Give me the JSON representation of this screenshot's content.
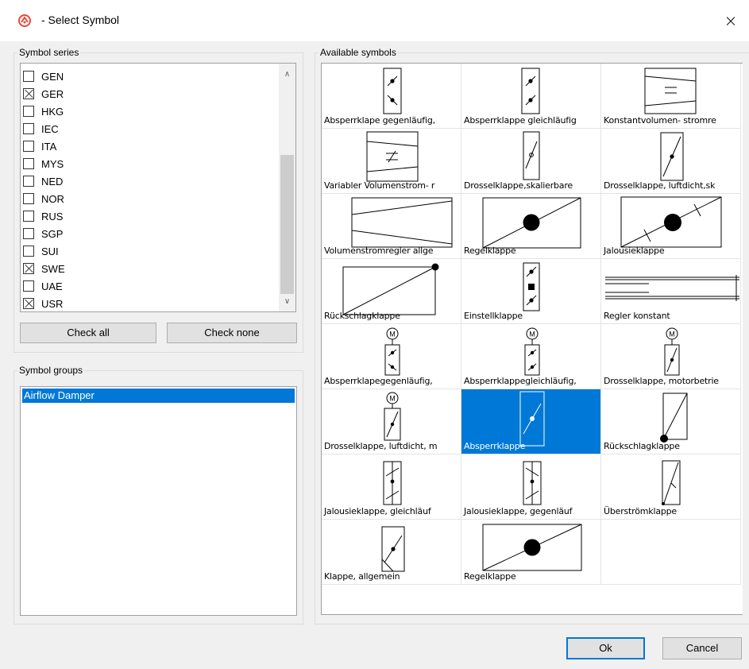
{
  "window": {
    "title": "- Select Symbol",
    "close_glyph": "×",
    "icon": "app-logo-icon"
  },
  "series": {
    "legend": "Symbol series",
    "items": [
      {
        "label": "GEN",
        "checked": false
      },
      {
        "label": "GER",
        "checked": true
      },
      {
        "label": "HKG",
        "checked": false
      },
      {
        "label": "IEC",
        "checked": false
      },
      {
        "label": "ITA",
        "checked": false
      },
      {
        "label": "MYS",
        "checked": false
      },
      {
        "label": "NED",
        "checked": false
      },
      {
        "label": "NOR",
        "checked": false
      },
      {
        "label": "RUS",
        "checked": false
      },
      {
        "label": "SGP",
        "checked": false
      },
      {
        "label": "SUI",
        "checked": false
      },
      {
        "label": "SWE",
        "checked": true
      },
      {
        "label": "UAE",
        "checked": false
      },
      {
        "label": "USR",
        "checked": true
      }
    ],
    "check_all_label": "Check all",
    "check_none_label": "Check none",
    "scroll_up_glyph": "∧",
    "scroll_down_glyph": "∨"
  },
  "groups": {
    "legend": "Symbol groups",
    "items": [
      {
        "label": "Airflow Damper",
        "selected": true
      }
    ]
  },
  "symbols": {
    "legend": "Available symbols",
    "items": [
      {
        "label": "Absperrklape gegenläufig,",
        "icon": "damper-opposed-icon"
      },
      {
        "label": "Absperrklappe gleichläufig",
        "icon": "damper-parallel-icon"
      },
      {
        "label": "Konstantvolumen- stromre",
        "icon": "constant-volume-icon"
      },
      {
        "label": "Variabler Volumenstrom- r",
        "icon": "variable-volume-icon"
      },
      {
        "label": "Drosselklappe,skalierbare",
        "icon": "throttle-scalable-icon"
      },
      {
        "label": "Drosselklappe, luftdicht,sk",
        "icon": "throttle-airtight-icon"
      },
      {
        "label": "Volumenstromregler allge",
        "icon": "volume-regulator-icon"
      },
      {
        "label": "Regelklappe",
        "icon": "control-damper-icon"
      },
      {
        "label": "Jalousieklappe",
        "icon": "louvre-damper-icon"
      },
      {
        "label": "Rückschlagklappe",
        "icon": "check-damper-icon"
      },
      {
        "label": "Einstellklappe",
        "icon": "adjusting-damper-icon"
      },
      {
        "label": "Regler konstant",
        "icon": "regulator-constant-icon"
      },
      {
        "label": "Absperrklapegegenläufig,",
        "icon": "motor-damper-opposed-icon"
      },
      {
        "label": "Absperrklappegleichläufig,",
        "icon": "motor-damper-parallel-icon"
      },
      {
        "label": "Drosselklappe, motorbetrie",
        "icon": "motor-throttle-icon"
      },
      {
        "label": "Drosselklappe, luftdicht, m",
        "icon": "motor-throttle-airtight-icon"
      },
      {
        "label": "Absperrklappe",
        "icon": "shutoff-damper-icon",
        "selected": true
      },
      {
        "label": "Rückschlagklappe",
        "icon": "check-damper-2-icon"
      },
      {
        "label": "Jalousieklappe, gleichläuf",
        "icon": "louvre-parallel-icon"
      },
      {
        "label": "Jalousieklappe, gegenläuf",
        "icon": "louvre-opposed-icon"
      },
      {
        "label": "Überströmklappe",
        "icon": "overflow-damper-icon"
      },
      {
        "label": "Klappe, allgemein",
        "icon": "damper-general-icon"
      },
      {
        "label": "Regelklappe",
        "icon": "control-damper-2-icon"
      }
    ],
    "motor_glyph": "M"
  },
  "footer": {
    "ok_label": "Ok",
    "cancel_label": "Cancel"
  },
  "colors": {
    "accent": "#0078d7",
    "window_bg": "#f0f0f0",
    "logo": "#e8473c"
  }
}
